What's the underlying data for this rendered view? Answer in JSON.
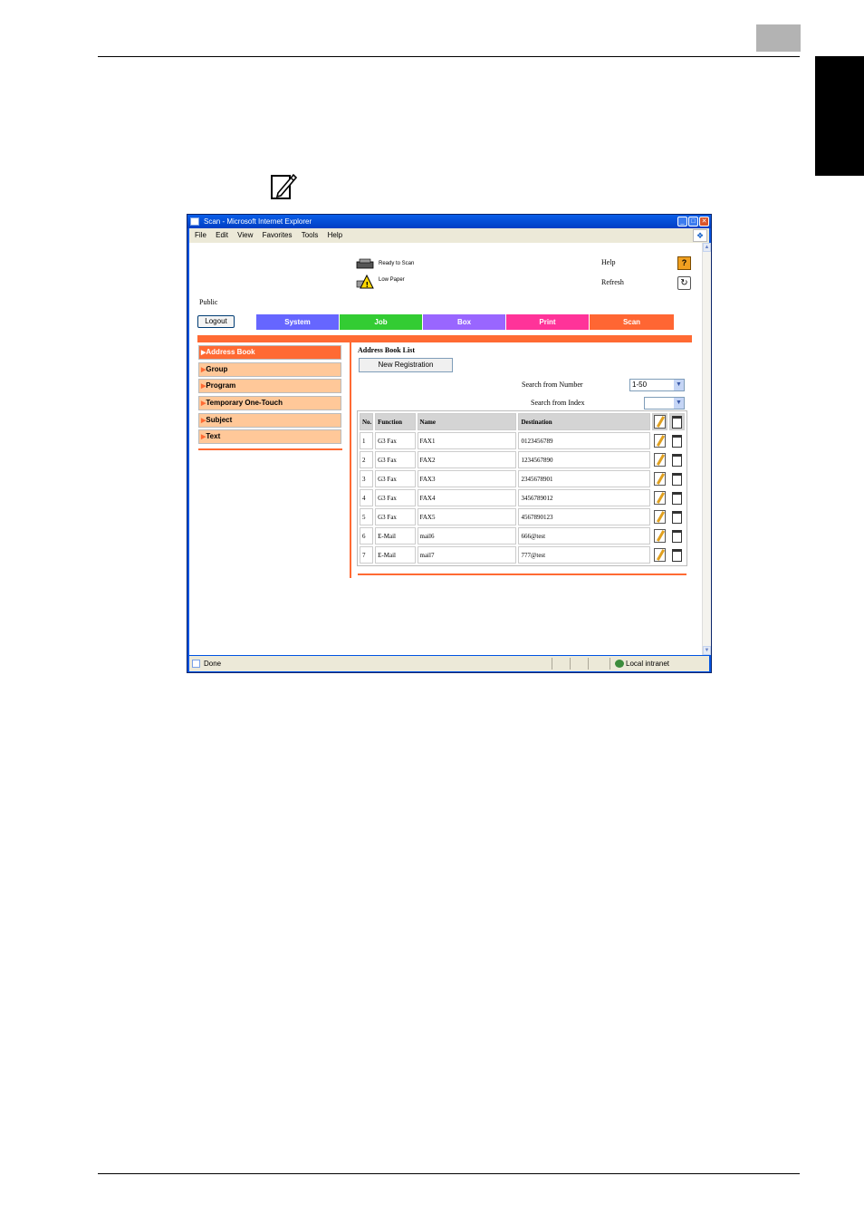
{
  "window": {
    "title": "Scan - Microsoft Internet Explorer",
    "menu": [
      "File",
      "Edit",
      "View",
      "Favorites",
      "Tools",
      "Help"
    ],
    "status_text": "Done",
    "zone_text": "Local intranet"
  },
  "header": {
    "status_ready": "Ready to Scan",
    "status_paper": "Low Paper",
    "user_mode": "Public",
    "help_label": "Help",
    "refresh_label": "Refresh",
    "logout_label": "Logout"
  },
  "tabs": [
    {
      "label": "System",
      "color": "#6666ff"
    },
    {
      "label": "Job",
      "color": "#33cc33"
    },
    {
      "label": "Box",
      "color": "#9966ff"
    },
    {
      "label": "Print",
      "color": "#ff3399"
    },
    {
      "label": "Scan",
      "color": "#ff6633"
    }
  ],
  "sidebar": {
    "items": [
      {
        "label": "Address Book"
      },
      {
        "label": "Group"
      },
      {
        "label": "Program"
      },
      {
        "label": "Temporary One-Touch"
      },
      {
        "label": "Subject"
      },
      {
        "label": "Text"
      }
    ]
  },
  "main": {
    "title": "Address Book List",
    "new_registration": "New Registration",
    "search_number_label": "Search from Number",
    "search_number_value": "1-50",
    "search_index_label": "Search from Index",
    "search_index_value": "",
    "columns": [
      "No.",
      "Function",
      "Name",
      "Destination"
    ],
    "rows": [
      [
        "1",
        "G3 Fax",
        "FAX1",
        "0123456789"
      ],
      [
        "2",
        "G3 Fax",
        "FAX2",
        "1234567890"
      ],
      [
        "3",
        "G3 Fax",
        "FAX3",
        "2345678901"
      ],
      [
        "4",
        "G3 Fax",
        "FAX4",
        "3456789012"
      ],
      [
        "5",
        "G3 Fax",
        "FAX5",
        "4567890123"
      ],
      [
        "6",
        "E-Mail",
        "mail6",
        "666@test"
      ],
      [
        "7",
        "E-Mail",
        "mail7",
        "777@test"
      ]
    ]
  }
}
